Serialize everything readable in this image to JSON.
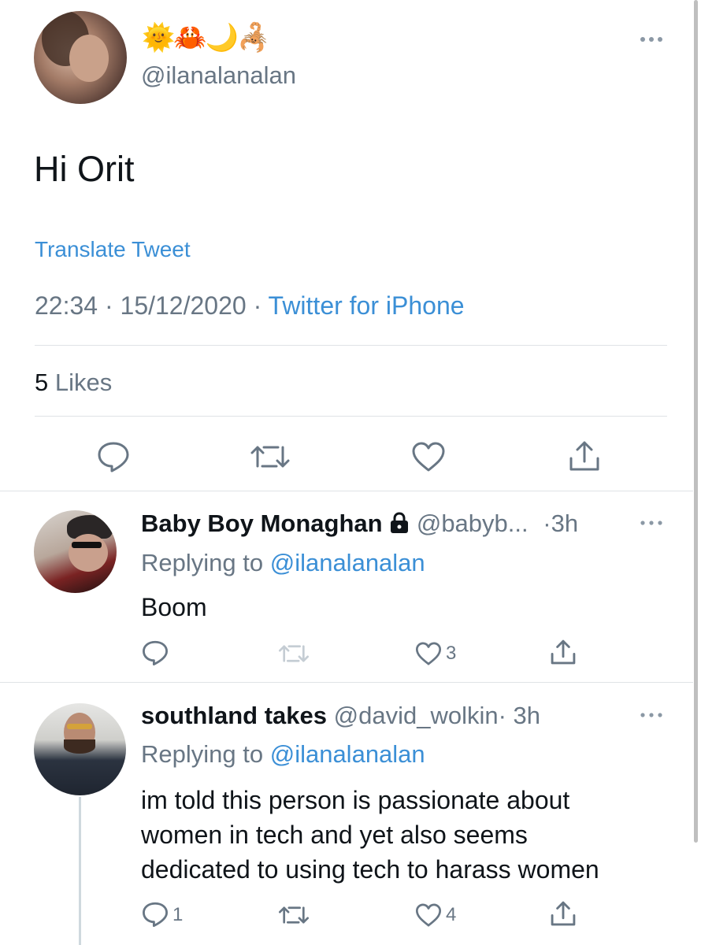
{
  "tweet": {
    "emoji_name": "🌞🦀🌙🦂",
    "handle": "@ilanalanalan",
    "text": "Hi Orit",
    "translate": "Translate Tweet",
    "time": "22:34",
    "date": "15/12/2020",
    "sep": "·",
    "source": "Twitter for iPhone",
    "likes_count": "5",
    "likes_label": "Likes"
  },
  "replies": [
    {
      "name": "Baby Boy Monaghan",
      "handle": "@babyb...",
      "time": "·3h",
      "replying_prefix": "Replying to",
      "replying_handle": "@ilanalanalan",
      "text": "Boom",
      "reply_count": "",
      "like_count": "3"
    },
    {
      "name": "southland takes",
      "handle": "@david_wolkin",
      "time": "· 3h",
      "replying_prefix": "Replying to",
      "replying_handle": "@ilanalanalan",
      "text_lines": [
        "im told this person is passionate about",
        "women in tech and yet also seems",
        "dedicated to using tech to harass women"
      ],
      "reply_count": "1",
      "like_count": "4"
    }
  ],
  "colors": {
    "link": "#3b8fd6",
    "gray": "#687684",
    "divider": "#dfe3e6"
  }
}
